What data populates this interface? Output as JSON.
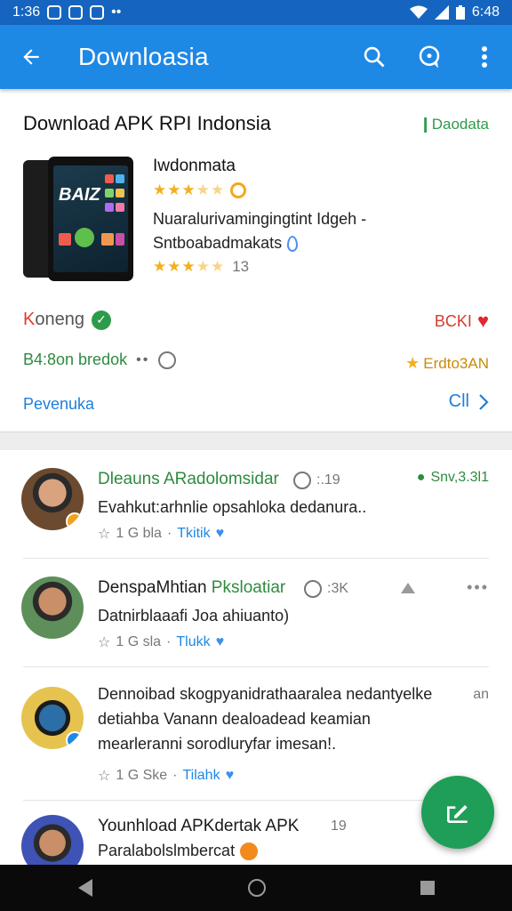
{
  "statusbar": {
    "time": "1:36",
    "right_time": "6:48"
  },
  "appbar": {
    "title": "Downloasia"
  },
  "header": {
    "heading": "Download APK RPI Indonsia",
    "action": "Daodata"
  },
  "app": {
    "name": "Iwdonmata",
    "desc_line1": "Nuaralurivamingingtint Idgeh -",
    "desc_line2": "Sntboabadmakats",
    "rating_count": "13"
  },
  "info": {
    "status_initial": "K",
    "status_rest": "oneng",
    "status_right": "BCKI",
    "downloads": "B4:8on bredok",
    "downloads_right": "Erdto3AN",
    "link_left": "Pevenuka",
    "link_right": "Cll"
  },
  "comments": [
    {
      "name": "Dleauns ARadolomsidar",
      "meta": ":.19",
      "right": "Snv,3.3l1",
      "text": "Evahkut:arhnlie opsahloka dedanura..",
      "actions": "1 G bla",
      "like": "Tkitik"
    },
    {
      "name_a": "DenspaMhtian ",
      "name_b": "Pksloatiar",
      "meta": ":3K",
      "text": "Datnirblaaafi Joa ahiuanto)",
      "actions": "1 G sla",
      "like": "Tlukk"
    },
    {
      "line1": "Dennoibad skogpyanidrathaaralea nedantyelke",
      "meta": "an",
      "line2": "detiahba Vanann dealoadead keamian",
      "line3": "mearleranni sorodluryfar imesan!.",
      "actions": "1 G Ske",
      "like": "Tilahk"
    },
    {
      "name": "Younhload APKdertak APK",
      "meta": "19",
      "text": "Paralabolslmbercat"
    }
  ],
  "colors": {
    "primary": "#1e88e5",
    "statusbar": "#1565c0",
    "fab": "#1e9e57",
    "green": "#2e8b3f",
    "red": "#e0262e"
  }
}
